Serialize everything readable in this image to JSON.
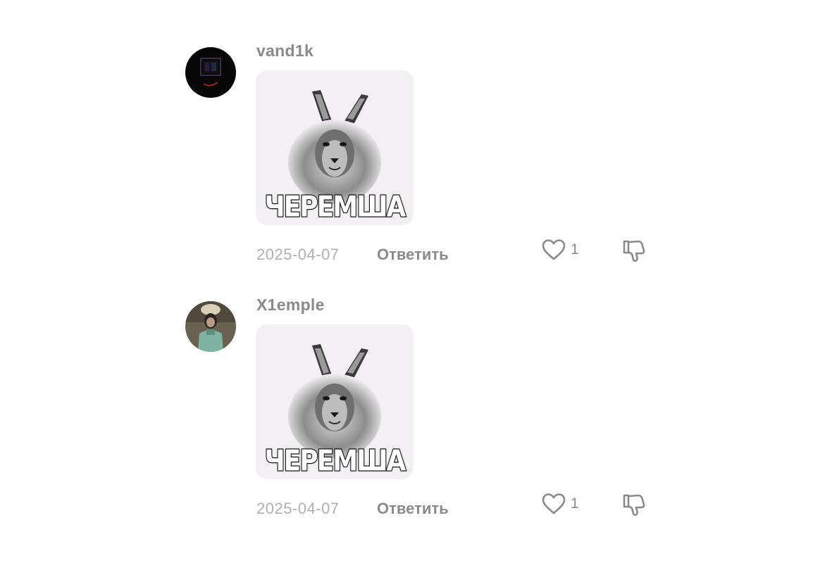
{
  "comments": [
    {
      "username": "vand1k",
      "sticker_caption": "ЧЕРЕМША",
      "date": "2025-04-07",
      "reply_label": "Ответить",
      "likes": "1",
      "avatar_icon": "dark-logo-avatar"
    },
    {
      "username": "X1emple",
      "sticker_caption": "ЧЕРЕМША",
      "date": "2025-04-07",
      "reply_label": "Ответить",
      "likes": "1",
      "avatar_icon": "photo-avatar"
    }
  ],
  "colors": {
    "username": "#8a8a8a",
    "date": "#b0b0b0",
    "sticker_bg": "#f2f0f2"
  }
}
